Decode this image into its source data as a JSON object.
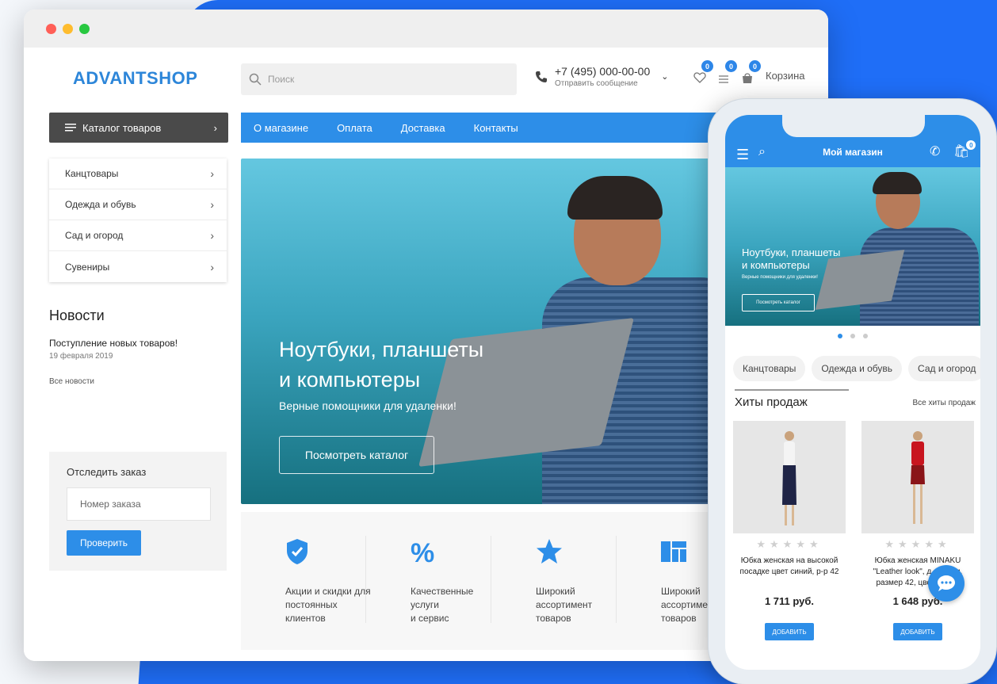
{
  "desktop": {
    "logo": "ADVANTSHOP",
    "search_placeholder": "Поиск",
    "phone_number": "+7 (495) 000-00-00",
    "send_message": "Отправить сообщение",
    "badges": {
      "wishlist": "0",
      "compare": "0",
      "cart": "0"
    },
    "cart_label": "Корзина",
    "catalog_button": "Каталог товаров",
    "nav": [
      "О магазине",
      "Оплата",
      "Доставка",
      "Контакты"
    ],
    "categories": [
      "Канцтовары",
      "Одежда и обувь",
      "Сад и огород",
      "Сувениры"
    ],
    "news": {
      "title": "Новости",
      "item": "Поступление новых товаров!",
      "date": "19 февраля 2019",
      "all": "Все новости"
    },
    "track": {
      "title": "Отследить заказ",
      "placeholder": "Номер заказа",
      "button": "Проверить"
    },
    "hero": {
      "title_line1": "Ноутбуки, планшеты",
      "title_line2": "и компьютеры",
      "subtitle": "Верные помощники для удаленки!",
      "button": "Посмотреть каталог"
    },
    "features": [
      {
        "icon": "shield-check-icon",
        "lines": [
          "Акции и скидки для",
          "постоянных",
          "клиентов"
        ]
      },
      {
        "icon": "percent-icon",
        "lines": [
          "Качественные",
          "услуги",
          "и сервис"
        ]
      },
      {
        "icon": "star-icon",
        "lines": [
          "Широкий",
          "ассортимент",
          "товаров"
        ]
      },
      {
        "icon": "grid-icon",
        "lines": [
          "Широкий",
          "ассортимент",
          "товаров"
        ]
      }
    ]
  },
  "mobile": {
    "title": "Мой магазин",
    "cart_badge": "0",
    "hero": {
      "title_line1": "Ноутбуки, планшеты",
      "title_line2": "и компьютеры",
      "subtitle": "Верные помощники для удаленки!",
      "button": "Посмотреть каталог"
    },
    "chips": [
      "Канцтовары",
      "Одежда и обувь",
      "Сад и огород"
    ],
    "hits_title": "Хиты продаж",
    "hits_all": "Все хиты продаж",
    "products": [
      {
        "name": "Юбка женская на высокой посадке цвет синий, р-р 42",
        "price": "1 711 руб.",
        "button": "ДОБАВИТЬ",
        "rating": 0
      },
      {
        "name": "Юбка женская MINAKU \"Leather look\", д… мини, размер 42, цве… …ый",
        "price": "1 648 руб.",
        "button": "ДОБАВИТЬ",
        "rating": 0
      }
    ]
  },
  "colors": {
    "accent": "#2d8ee8",
    "logo": "#2d86d9",
    "dark_button": "#4a4a4a",
    "backdrop": "#1f6ef7"
  }
}
